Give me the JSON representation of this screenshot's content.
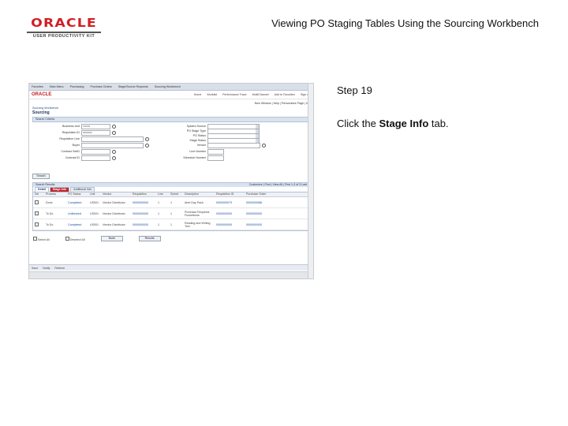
{
  "logo": {
    "word": "ORACLE",
    "sub": "USER PRODUCTIVITY KIT"
  },
  "title": "Viewing PO Staging Tables Using the Sourcing Workbench",
  "step": "Step 19",
  "instruction": {
    "prefix": "Click the ",
    "target": "Stage Info",
    "suffix": " tab."
  },
  "screenshot": {
    "topbar": [
      "Favorites",
      "Main Menu",
      "Purchasing",
      "Purchase Orders",
      "Stage/Source Requests",
      "Sourcing Workbench"
    ],
    "brand": "ORACLE",
    "links": [
      "Home",
      "Worklist",
      "Performance Trace",
      "MultiChannel",
      "Add to Favorites",
      "Sign out"
    ],
    "right_links": "New Window | Help | Personalize Page | http",
    "breadcrumb": "Sourcing Workbench",
    "heading": "Sourcing",
    "criteria_label": "Search Criteria",
    "form_left": [
      {
        "label": "Business Unit",
        "value": "US001"
      },
      {
        "label": "Requisition ID",
        "value": "0000000"
      },
      {
        "label": "Requisition Line",
        "value": ""
      },
      {
        "label": "Buyer",
        "value": ""
      },
      {
        "label": "Contract SetID",
        "value": ""
      },
      {
        "label": "Contract ID",
        "value": ""
      }
    ],
    "form_right": [
      "System Source",
      "PO Stage Type",
      "PO Status",
      "Stage Status",
      "Vendor",
      "Line Number",
      "Schedule Number"
    ],
    "search_btn": "Search",
    "results_label": "Search Results",
    "results_nav": "Customize | Find | View All | First 1-3 of 3 Last",
    "tabs": [
      "Detail",
      "Stage Info",
      "Additional Info"
    ],
    "columns": [
      "Sel",
      "Process",
      "PO Status",
      "Unit",
      "Vendor",
      "Requisition",
      "Line",
      "Sched",
      "Description",
      "Requisition ID",
      "Purchase Order"
    ],
    "rows": [
      [
        "Done",
        "Completed",
        "US001",
        "Vendor Distributor",
        "0000000000",
        "1",
        "1",
        "Alert Day Pack",
        "0000000079",
        "0000000088"
      ],
      [
        "To Do",
        "Unfinished",
        "US001",
        "Vendor Distributor",
        "0000000000",
        "1",
        "1",
        "Purchase Requests Pocketbook",
        "0000000000",
        "0000000000"
      ],
      [
        "To Do",
        "Completed",
        "US001",
        "Vendor Distributor",
        "0000000000",
        "1",
        "1",
        "Reading and Writing Test",
        "0000000000",
        "0000000000"
      ]
    ],
    "select_all": "Select All",
    "deselect_all": "Deselect All",
    "build_btn": "Build",
    "results_btn": "Results",
    "bottom_buttons": [
      "Save",
      "Notify",
      "Refresh"
    ]
  }
}
